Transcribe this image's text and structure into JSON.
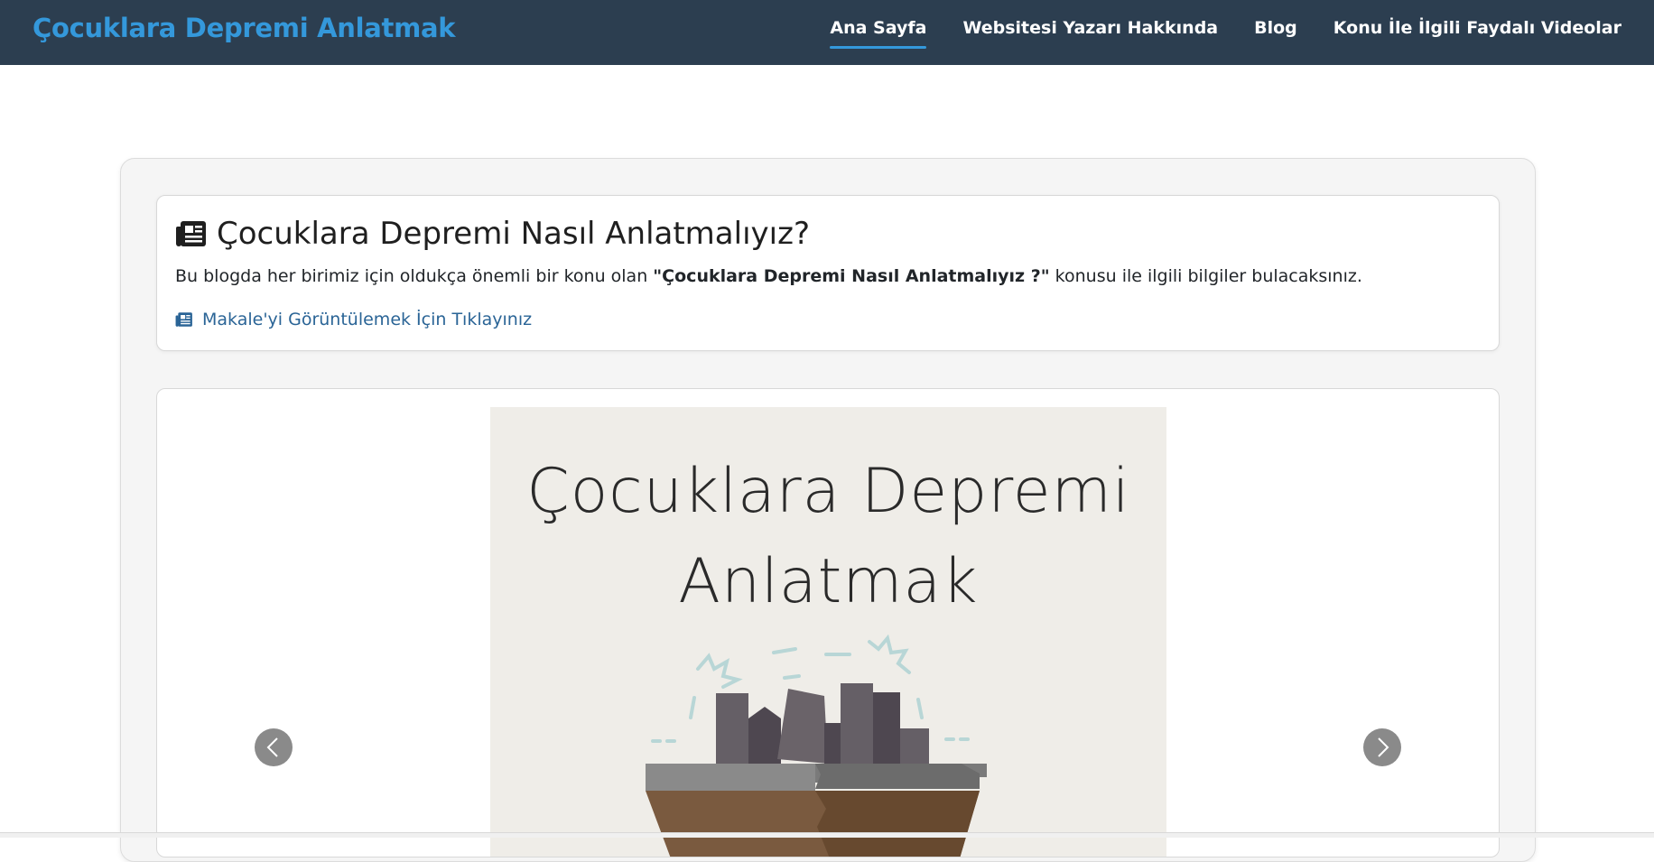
{
  "nav": {
    "brand": "Çocuklara Depremi Anlatmak",
    "links": [
      {
        "label": "Ana Sayfa",
        "active": true
      },
      {
        "label": "Websitesi Yazarı Hakkında",
        "active": false
      },
      {
        "label": "Blog",
        "active": false
      },
      {
        "label": "Konu İle İlgili Faydalı Videolar",
        "active": false
      }
    ]
  },
  "card": {
    "title_icon": "newspaper-icon",
    "title": "Çocuklara Depremi Nasıl Anlatmalıyız?",
    "text_before": "Bu blogda her birimiz için oldukça önemli bir konu olan ",
    "text_bold": "\"Çocuklara Depremi Nasıl Anlatmalıyız ?\"",
    "text_after": " konusu ile ilgili bilgiler bulacaksınız.",
    "link_icon": "newspaper-icon",
    "link_label": "Makale'yi Görüntülemek İçin Tıklayınız"
  },
  "carousel": {
    "slide_title_line1": "Çocuklara Depremi",
    "slide_title_line2": "Anlatmak",
    "prev_icon": "chevron-left-icon",
    "next_icon": "chevron-right-icon"
  },
  "colors": {
    "navbar_bg": "#2c3e50",
    "brand": "#3498db",
    "link": "#2a6496",
    "slide_bg": "#efede8"
  }
}
